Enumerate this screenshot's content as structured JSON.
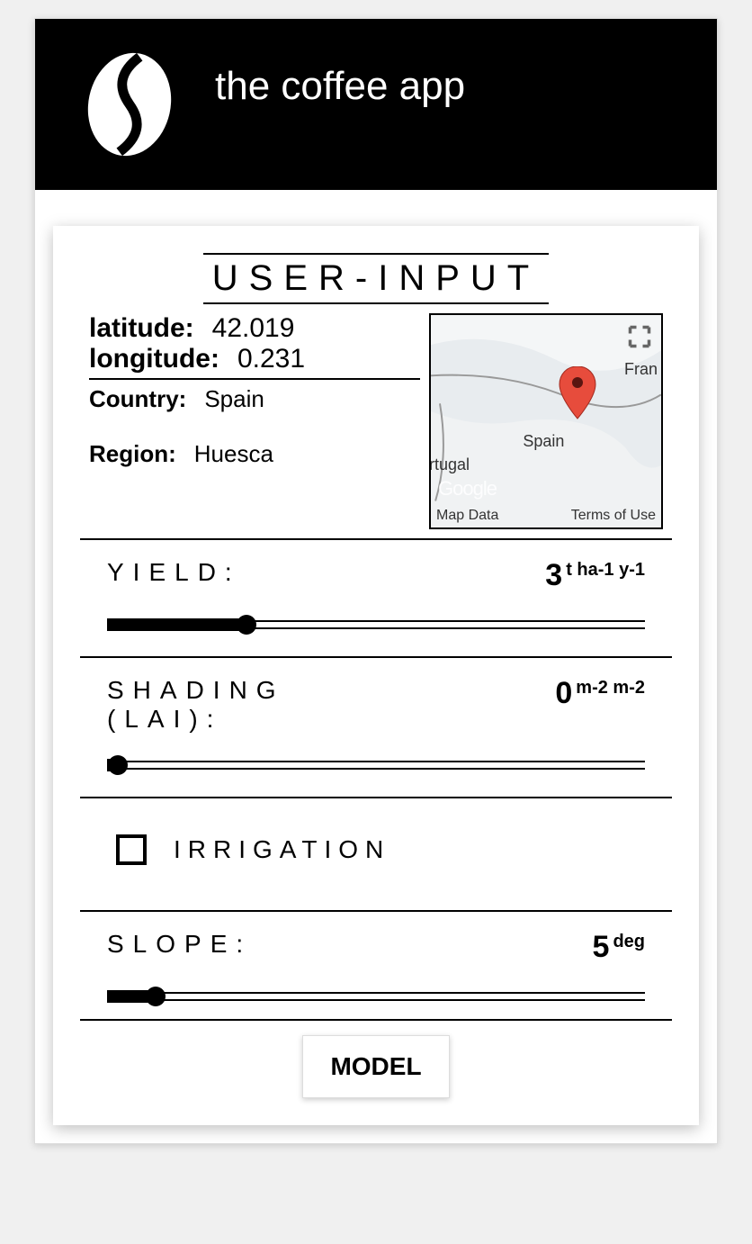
{
  "header": {
    "title": "the coffee app"
  },
  "card": {
    "title": "USER-INPUT",
    "coords": {
      "lat_label": "latitude:",
      "lat_value": "42.019",
      "lon_label": "longitude:",
      "lon_value": "0.231",
      "country_label": "Country:",
      "country_value": "Spain",
      "region_label": "Region:",
      "region_value": "Huesca"
    },
    "map": {
      "spain": "Spain",
      "portugal": "rtugal",
      "france": "Fran",
      "google": "Google",
      "map_data": "Map Data",
      "terms": "Terms of Use"
    },
    "yield": {
      "label": "YIELD:",
      "value": "3",
      "unit": "t ha-1 y-1",
      "percent": 26
    },
    "shading": {
      "label": "SHADING (LAI):",
      "value": "0",
      "unit": "m-2 m-2",
      "percent": 2
    },
    "irrigation": {
      "label": "IRRIGATION",
      "checked": false
    },
    "slope": {
      "label": "SLOPE:",
      "value": "5",
      "unit": "deg",
      "percent": 9
    },
    "model_button": "MODEL"
  }
}
